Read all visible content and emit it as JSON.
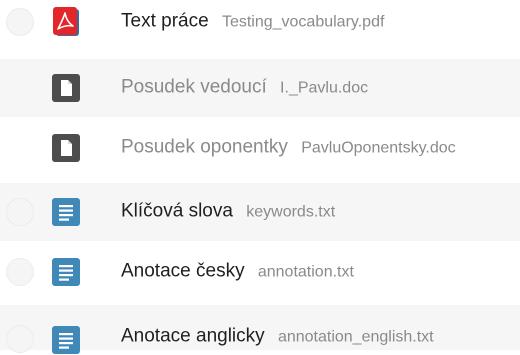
{
  "files": [
    {
      "title": "Text práce",
      "filename": "Testing_vocabulary.pdf",
      "icon": "pdf-icon",
      "icon_color": "#e02020"
    },
    {
      "title": "Posudek vedoucí",
      "filename": "I._Pavlu.doc",
      "icon": "document-icon",
      "icon_color": "#4d4d4d"
    },
    {
      "title": "Posudek oponentky",
      "filename": "PavluOponentsky.doc",
      "icon": "document-icon",
      "icon_color": "#4d4d4d"
    },
    {
      "title": "Klíčová slova",
      "filename": "keywords.txt",
      "icon": "text-file-icon",
      "icon_color": "#3f88b8"
    },
    {
      "title": "Anotace česky",
      "filename": "annotation.txt",
      "icon": "text-file-icon",
      "icon_color": "#3f88b8"
    },
    {
      "title": "Anotace anglicky",
      "filename": "annotation_english.txt",
      "icon": "text-file-icon",
      "icon_color": "#3f88b8"
    }
  ]
}
